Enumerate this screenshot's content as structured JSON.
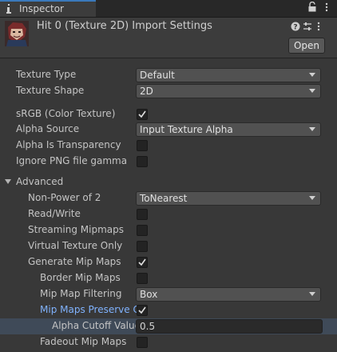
{
  "tab": {
    "title": "Inspector",
    "icon": "info-icon"
  },
  "header": {
    "asset_title": "Hit 0 (Texture 2D) Import Settings",
    "open_label": "Open",
    "icons": [
      "help-icon",
      "preset-icon",
      "more-icon"
    ]
  },
  "fields": {
    "texture_type": {
      "label": "Texture Type",
      "value": "Default"
    },
    "texture_shape": {
      "label": "Texture Shape",
      "value": "2D"
    },
    "srgb": {
      "label": "sRGB (Color Texture)",
      "checked": true
    },
    "alpha_source": {
      "label": "Alpha Source",
      "value": "Input Texture Alpha"
    },
    "alpha_is_transparency": {
      "label": "Alpha Is Transparency",
      "checked": false
    },
    "ignore_png_gamma": {
      "label": "Ignore PNG file gamma",
      "checked": false
    },
    "advanced": {
      "label": "Advanced"
    },
    "non_power_of_2": {
      "label": "Non-Power of 2",
      "value": "ToNearest"
    },
    "read_write": {
      "label": "Read/Write",
      "checked": false
    },
    "streaming_mipmaps": {
      "label": "Streaming Mipmaps",
      "checked": false
    },
    "virtual_texture_only": {
      "label": "Virtual Texture Only",
      "checked": false
    },
    "generate_mip_maps": {
      "label": "Generate Mip Maps",
      "checked": true
    },
    "border_mip_maps": {
      "label": "Border Mip Maps",
      "checked": false
    },
    "mip_map_filtering": {
      "label": "Mip Map Filtering",
      "value": "Box"
    },
    "mip_maps_preserve": {
      "label": "Mip Maps Preserve C",
      "checked": true
    },
    "alpha_cutoff": {
      "label": "Alpha Cutoff Value",
      "value": "0.5"
    },
    "fadeout_mip_maps": {
      "label": "Fadeout Mip Maps",
      "checked": false
    }
  },
  "colors": {
    "accent": "#3a79bb",
    "highlight_label": "#80b3ff",
    "background": "#383838"
  }
}
